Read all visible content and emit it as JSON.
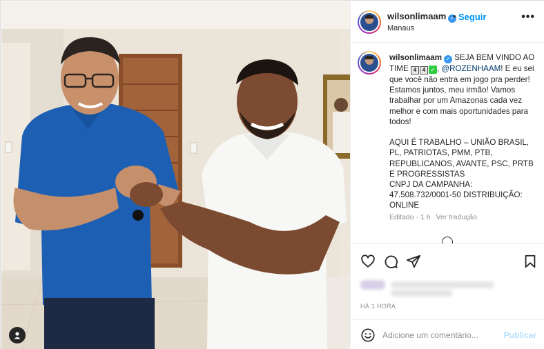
{
  "post": {
    "username": "wilsonlimaam",
    "verified_icon": "verified-badge-icon",
    "dot": "•",
    "follow_label": "Seguir",
    "location": "Manaus",
    "more_icon": "more-options-icon",
    "more_label": "•••"
  },
  "caption": {
    "username": "wilsonlimaam",
    "line1": "SEJA BEM VINDO AO TIME",
    "emoji_1": "4",
    "emoji_2": "4",
    "emoji_check": "✓",
    "mention": "@ROZENHAAM",
    "line2": "! E eu sei que você não entra em jogo pra perder! Estamos juntos, meu irmão! Vamos trabalhar por um Amazonas cada vez melhor e com mais oportunidades para todos!",
    "block2": "AQUI É TRABALHO – UNIÃO BRASIL, PL, PATRIOTAS, PMM, PTB, REPUBLICANOS, AVANTE, PSC, PRTB E PROGRESSISTAS\nCNPJ DA CAMPANHA: 47.508.732/0001-50 DISTRIBUIÇÃO: ONLINE",
    "edited": "Editado · 1 h",
    "see_translation": "Ver tradução"
  },
  "actions": {
    "like_icon": "heart-icon",
    "comment_icon": "comment-icon",
    "share_icon": "share-icon",
    "save_icon": "bookmark-icon",
    "timestamp": "HÁ 1 HORA"
  },
  "comment": {
    "emoji_icon": "emoji-icon",
    "placeholder": "Adicione um comentário...",
    "publish_label": "Publicar"
  },
  "photo": {
    "tag_icon": "user-tag-icon"
  },
  "colors": {
    "accent": "#0095f6",
    "publish_disabled": "#b2dffc",
    "verified": "#3897f0",
    "muted": "#8e8e8e"
  }
}
